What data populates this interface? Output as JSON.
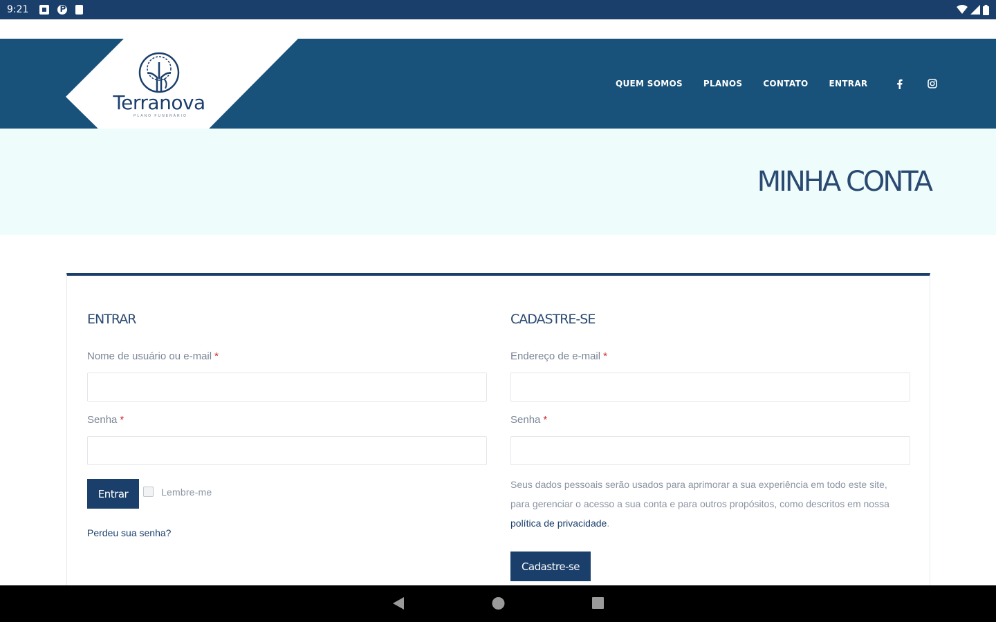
{
  "status_bar": {
    "time": "9:21"
  },
  "site": {
    "logo_text": "Terranova",
    "logo_subtitle": "PLANO FUNERÁRIO",
    "nav": [
      {
        "label": "QUEM SOMOS"
      },
      {
        "label": "PLANOS"
      },
      {
        "label": "CONTATO"
      },
      {
        "label": "ENTRAR"
      }
    ],
    "social": [
      "facebook-icon",
      "instagram-icon"
    ]
  },
  "banner": {
    "title": "MINHA CONTA"
  },
  "login": {
    "title": "ENTRAR",
    "username_label": "Nome de usuário ou e-mail",
    "username_value": "",
    "password_label": "Senha",
    "password_value": "",
    "submit_label": "Entrar",
    "remember_label": "Lembre-me",
    "lost_password": "Perdeu sua senha?"
  },
  "register": {
    "title": "CADASTRE-SE",
    "email_label": "Endereço de e-mail",
    "email_value": "",
    "password_label": "Senha",
    "password_value": "",
    "privacy_text_before": "Seus dados pessoais serão usados para aprimorar a sua experiência em todo este site, para gerenciar o acesso a sua conta e para outros propósitos, como descritos em nossa ",
    "privacy_link": "política de privacidade",
    "privacy_text_after": ".",
    "submit_label": "Cadastre-se"
  },
  "required_mark": "*",
  "colors": {
    "brand_blue": "#185179",
    "dark_blue": "#1b3f6b",
    "banner_bg": "#eefcfc",
    "required_red": "#d12a2a"
  }
}
